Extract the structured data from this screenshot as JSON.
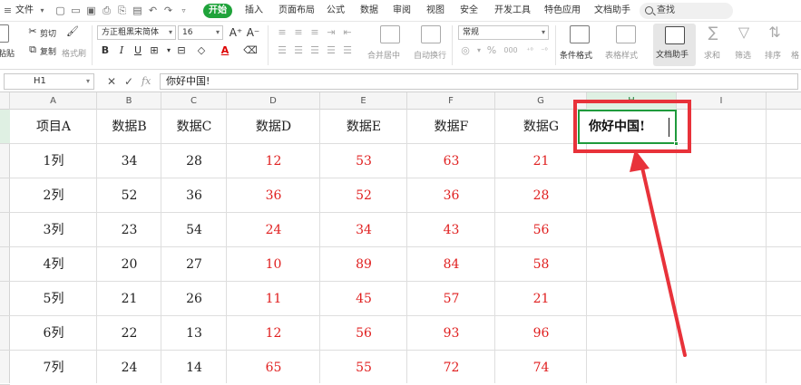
{
  "menubar": {
    "file": "文件",
    "tabs": [
      "开始",
      "插入",
      "页面布局",
      "公式",
      "数据",
      "审阅",
      "视图",
      "安全",
      "开发工具",
      "特色应用",
      "文档助手"
    ],
    "search_label": "查找"
  },
  "ribbon": {
    "paste": "粘贴",
    "cut": "剪切",
    "copy": "复制",
    "format_painter": "格式刷",
    "font_name": "方正粗黑宋简体",
    "font_size": "16",
    "bold": "B",
    "italic": "I",
    "underline": "U",
    "font_color": "A",
    "merge_center": "合并居中",
    "wrap_text": "自动换行",
    "number_format": "常规",
    "percent": "%",
    "thousands": "000",
    "conditional_format": "条件格式",
    "table_style": "表格样式",
    "doc_helper": "文档助手",
    "sum": "求和",
    "filter": "筛选",
    "sort": "排序",
    "format": "格"
  },
  "formula_bar": {
    "cell_ref": "H1",
    "fx": "fx",
    "content": "你好中国!"
  },
  "columns": [
    "A",
    "B",
    "C",
    "D",
    "E",
    "F",
    "G",
    "H",
    "I"
  ],
  "table": {
    "headers": [
      "项目A",
      "数据B",
      "数据C",
      "数据D",
      "数据E",
      "数据F",
      "数据G"
    ],
    "rows": [
      [
        "1列",
        "34",
        "28",
        "12",
        "53",
        "63",
        "21"
      ],
      [
        "2列",
        "52",
        "36",
        "36",
        "52",
        "36",
        "28"
      ],
      [
        "3列",
        "23",
        "54",
        "24",
        "34",
        "43",
        "56"
      ],
      [
        "4列",
        "20",
        "27",
        "10",
        "89",
        "84",
        "58"
      ],
      [
        "5列",
        "21",
        "26",
        "11",
        "45",
        "57",
        "21"
      ],
      [
        "6列",
        "22",
        "13",
        "12",
        "56",
        "93",
        "96"
      ],
      [
        "7列",
        "24",
        "14",
        "65",
        "55",
        "72",
        "74"
      ]
    ],
    "red_columns": [
      3,
      4,
      5,
      6
    ]
  },
  "h1_cell": "你好中国!",
  "colors": {
    "accent_green": "#1fa33a",
    "highlight_red": "#e8323a",
    "value_red": "#e02020"
  }
}
